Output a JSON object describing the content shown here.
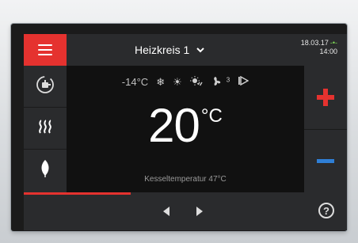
{
  "header": {
    "menu_icon": "hamburger-menu-icon",
    "circuit_label": "Heizkreis 1",
    "date": "18.03.17",
    "time": "14:00",
    "connection_icon": "plug-icon"
  },
  "sidebar": {
    "items": [
      {
        "icon": "hot-water-tap-icon"
      },
      {
        "icon": "heating-waves-icon"
      },
      {
        "icon": "eco-leaf-icon"
      }
    ]
  },
  "status": {
    "outdoor_temp": "-14°C",
    "icons": [
      "snowflake-icon",
      "sun-icon",
      "sun-cloud-icon",
      "fan-level-3-icon",
      "valve-icon"
    ],
    "fan_level": "3"
  },
  "setpoint": {
    "value": "20",
    "unit": "°C"
  },
  "boiler": {
    "label": "Kesseltemperatur",
    "value": "47°C"
  },
  "controls": {
    "increase_icon": "plus-icon",
    "decrease_icon": "minus-icon"
  },
  "progress": {
    "fraction": 0.33
  },
  "footer": {
    "prev_icon": "arrow-left-icon",
    "next_icon": "arrow-right-icon",
    "help_label": "?"
  },
  "colors": {
    "accent": "#e5322f",
    "minus": "#2f7fd6",
    "panel": "#2a2b2d"
  }
}
